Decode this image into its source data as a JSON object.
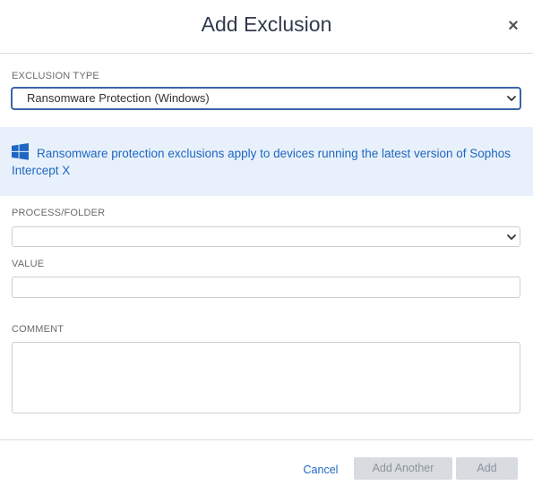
{
  "dialog": {
    "title": "Add Exclusion",
    "close_glyph": "×"
  },
  "exclusion_type": {
    "label": "EXCLUSION TYPE",
    "selected": "Ransomware Protection (Windows)"
  },
  "info": {
    "icon": "windows-icon",
    "text": "Ransomware protection exclusions apply to devices running the latest version of Sophos Intercept X"
  },
  "process_folder": {
    "label": "PROCESS/FOLDER",
    "selected": ""
  },
  "value": {
    "label": "VALUE",
    "value": ""
  },
  "comment": {
    "label": "COMMENT",
    "value": ""
  },
  "footer": {
    "cancel_label": "Cancel",
    "add_another_label": "Add Another",
    "add_label": "Add"
  },
  "colors": {
    "link": "#1f66c1",
    "info_bg": "#e8f1fb",
    "disabled_bg": "#d8dbe0",
    "focus_border": "#3c63a8"
  }
}
